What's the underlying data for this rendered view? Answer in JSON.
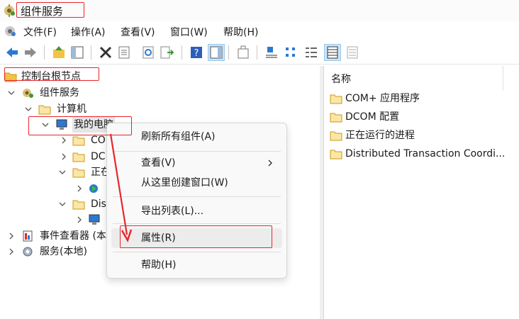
{
  "window": {
    "title": "组件服务"
  },
  "menubar": {
    "items": [
      "文件(F)",
      "操作(A)",
      "查看(V)",
      "窗口(W)",
      "帮助(H)"
    ]
  },
  "toolbar": {
    "buttons": [
      "back-icon",
      "forward-icon",
      "up-folder-icon",
      "show-hide-tree-icon",
      "delete-icon",
      "properties-icon",
      "refresh-icon",
      "export-list-icon",
      "help-icon",
      "show-hide-action-pane-icon",
      "new-window-icon",
      "large-icons-view-icon",
      "small-icons-view-icon",
      "list-view-icon",
      "detail-view-icon",
      "status-view-icon"
    ]
  },
  "tree": {
    "root": "控制台根节点",
    "component_services": "组件服务",
    "computers": "计算机",
    "my_computer": "我的电脑",
    "com_apps_truncated": "CO",
    "dcom_truncated": "DC",
    "running_truncated": "正在",
    "distributed_truncated": "Dis",
    "event_viewer": "事件查看器 (本",
    "services_local": "服务(本地)"
  },
  "list": {
    "column_header": "名称",
    "items": [
      "COM+ 应用程序",
      "DCOM 配置",
      "正在运行的进程",
      "Distributed Transaction Coordi..."
    ]
  },
  "context_menu": {
    "refresh_all": "刷新所有组件(A)",
    "view": "查看(V)",
    "new_window": "从这里创建窗口(W)",
    "export_list": "导出列表(L)...",
    "properties": "属性(R)",
    "help": "帮助(H)"
  },
  "colors": {
    "annotation_red": "#e8262b",
    "folder_yellow": "#f3c443",
    "selection_blue": "#cce4f7",
    "toolbar_blue": "#2a7ad2"
  }
}
